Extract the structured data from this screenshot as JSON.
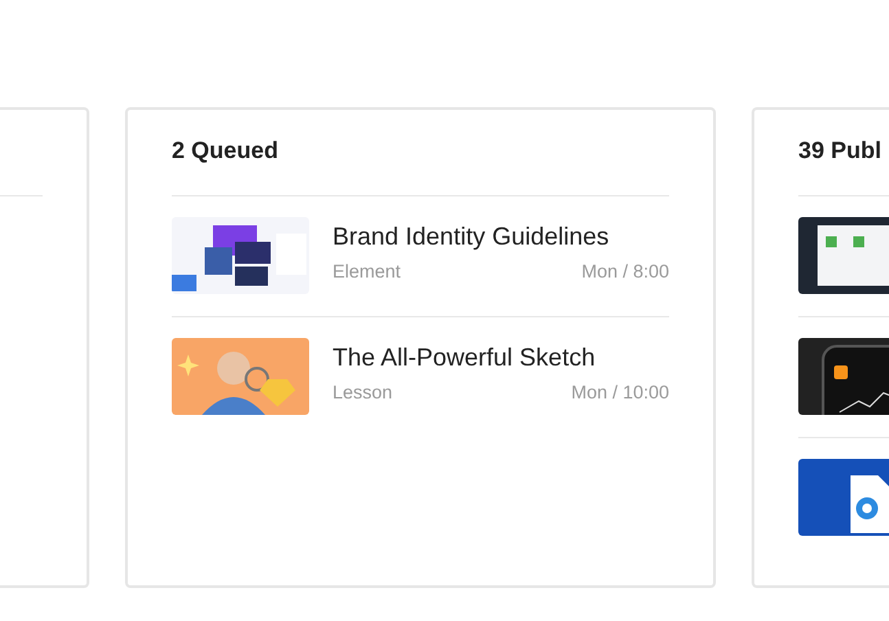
{
  "cards": [
    {
      "kind": "empty"
    },
    {
      "kind": "list",
      "title": "2 Queued",
      "items": [
        {
          "kind": "slides",
          "title": "Brand Identity Guidelines",
          "type": "Element",
          "time": "Mon / 8:00"
        },
        {
          "kind": "illustration",
          "title": "The All-Powerful Sketch",
          "type": "Lesson",
          "time": "Mon / 10:00"
        }
      ]
    },
    {
      "kind": "list",
      "title": "39 Publ",
      "items": [
        {
          "kind": "dashboard"
        },
        {
          "kind": "phone"
        },
        {
          "kind": "document"
        }
      ]
    }
  ]
}
